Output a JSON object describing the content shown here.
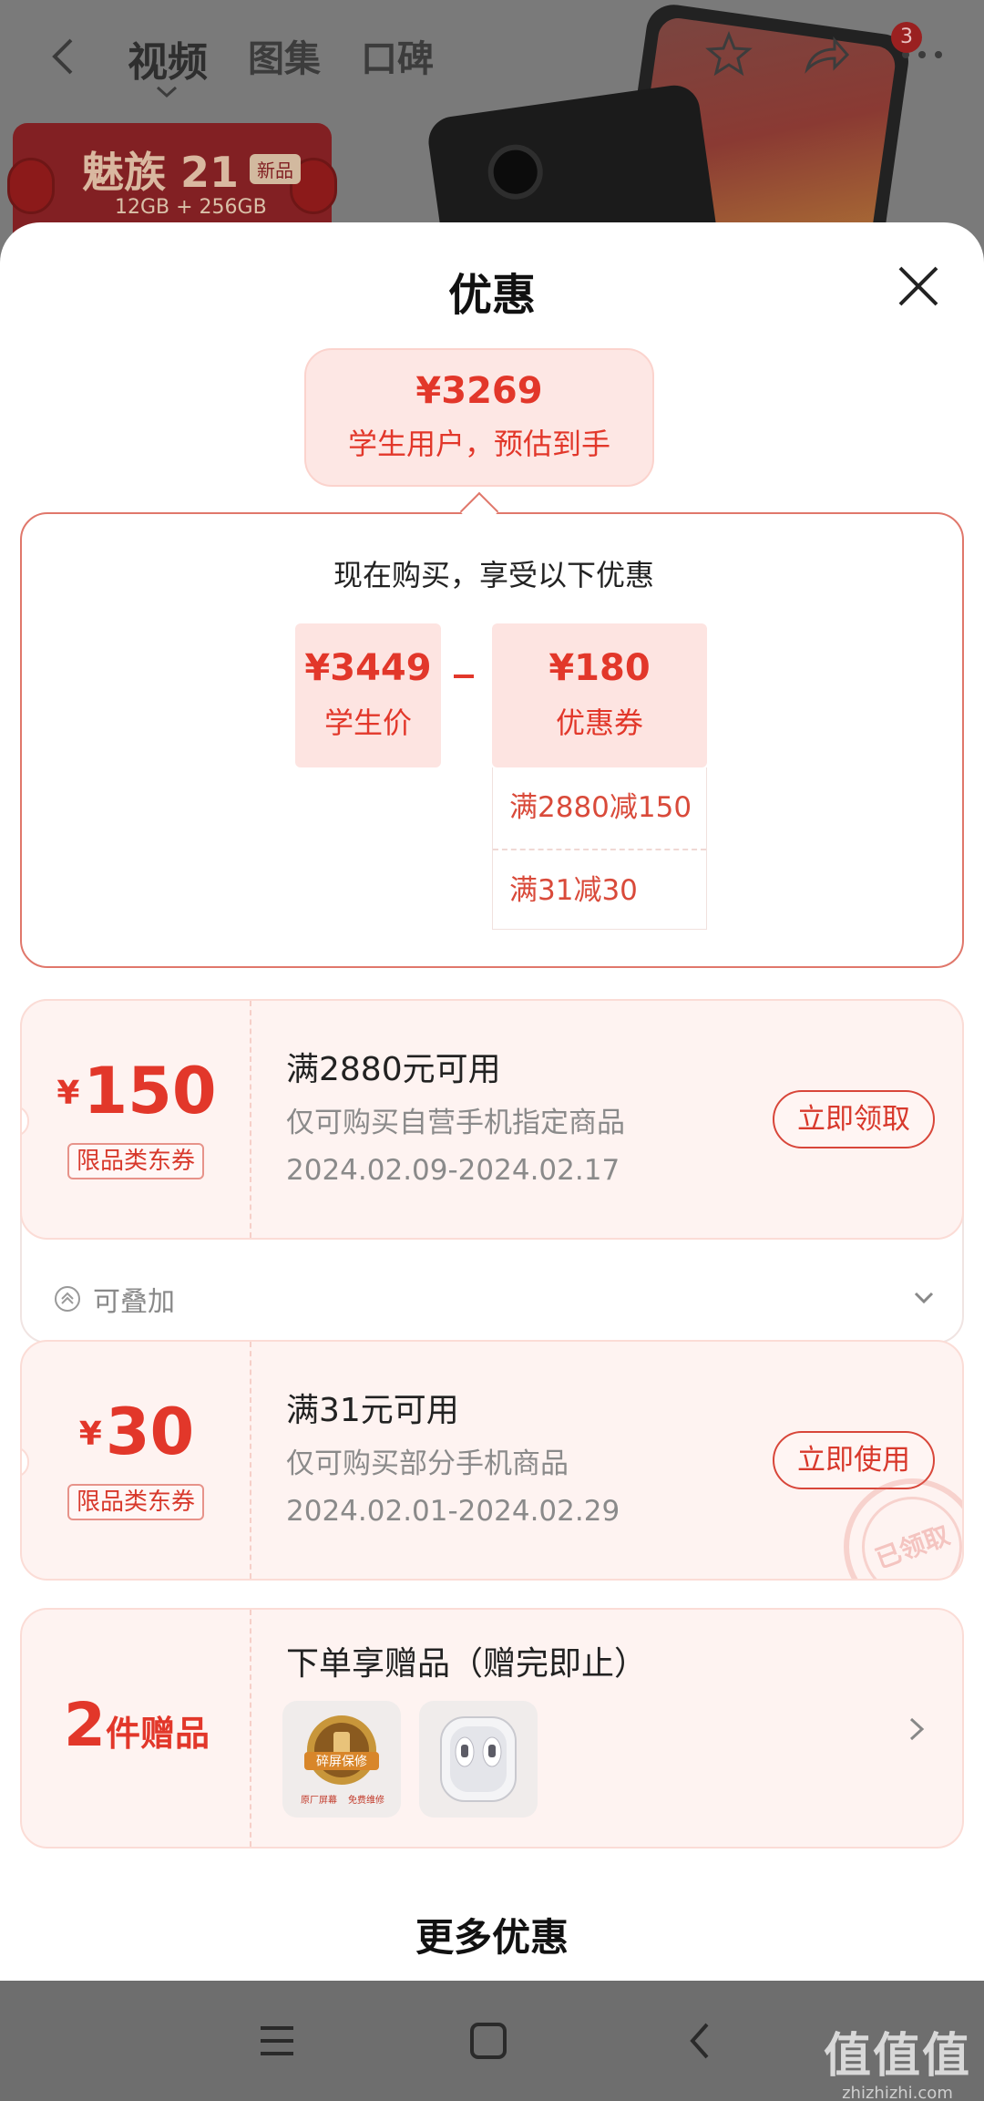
{
  "background": {
    "tabs": [
      "视频",
      "图集",
      "口碑"
    ],
    "badge_count": "3",
    "banner_title": "魅族 21",
    "banner_new": "新品",
    "banner_spec": "12GB + 256GB"
  },
  "sheet": {
    "title": "优惠",
    "estimate": {
      "price": "¥3269",
      "label": "学生用户，预估到手"
    },
    "calc": {
      "title": "现在购买，享受以下优惠",
      "student_price": {
        "value": "¥3449",
        "label": "学生价"
      },
      "coupon": {
        "value": "¥180",
        "label": "优惠券"
      },
      "rules": [
        "满2880减150",
        "满31减30"
      ]
    },
    "coupons": [
      {
        "yen": "¥",
        "amount": "150",
        "tag": "限品类东券",
        "title": "满2880元可用",
        "desc": "仅可购买自营手机指定商品",
        "date": "2024.02.09-2024.02.17",
        "button": "立即领取",
        "stackable": "可叠加"
      },
      {
        "yen": "¥",
        "amount": "30",
        "tag": "限品类东券",
        "title": "满31元可用",
        "desc": "仅可购买部分手机商品",
        "date": "2024.02.01-2024.02.29",
        "button": "立即使用",
        "stamp": "已领取"
      }
    ],
    "gift": {
      "count": "2",
      "count_label": "件赠品",
      "title": "下单享赠品（赠完即止）",
      "item1_badge": "碎屏保修",
      "item1_caption_a": "原厂屏幕",
      "item1_caption_b": "免费维修"
    },
    "more_title": "更多优惠"
  },
  "watermark": {
    "big": "值值值",
    "small": "zhizhizhi.com"
  },
  "colors": {
    "accent": "#e2372a",
    "card_bg": "#fef3f1",
    "estimate_bg": "#fde7e4"
  }
}
